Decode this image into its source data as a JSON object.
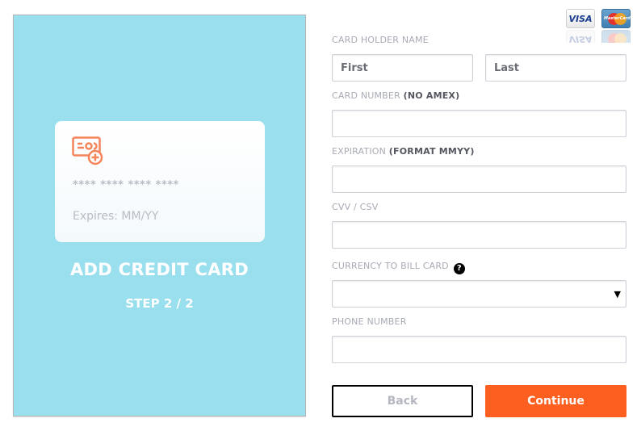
{
  "left_panel": {
    "card_preview": {
      "icon": "credit-card-add-icon",
      "number_mask": "**** **** **** ****",
      "expires": "Expires: MM/YY"
    },
    "title": "ADD CREDIT CARD",
    "step": "STEP 2 / 2"
  },
  "brand_logos": {
    "visa": "VISA",
    "mastercard": "MasterCard"
  },
  "form": {
    "card_holder": {
      "label": "CARD HOLDER NAME",
      "first_placeholder": "First",
      "last_placeholder": "Last"
    },
    "card_number": {
      "label": "CARD NUMBER",
      "note": "(NO AMEX)",
      "value": ""
    },
    "expiration": {
      "label": "EXPIRATION",
      "note": "(FORMAT MMYY)",
      "value": ""
    },
    "cvv": {
      "label": "CVV / CSV",
      "value": ""
    },
    "currency": {
      "label": "CURRENCY TO BILL CARD",
      "help_icon": "?",
      "selected": "",
      "arrow": "▼"
    },
    "phone": {
      "label": "PHONE NUMBER",
      "value": ""
    }
  },
  "buttons": {
    "back": "Back",
    "continue": "Continue"
  },
  "colors": {
    "panel_bg": "#9adfed",
    "accent": "#fd5f20",
    "icon": "#f5845a"
  }
}
